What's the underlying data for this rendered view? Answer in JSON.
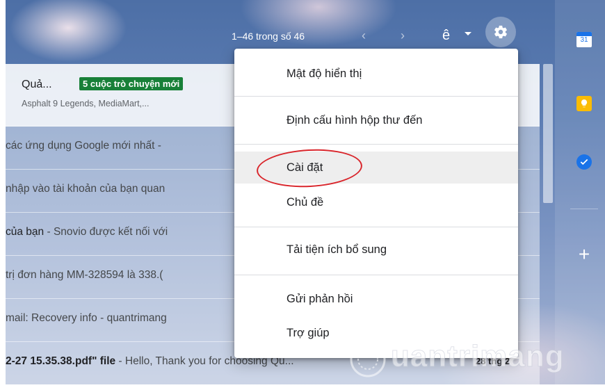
{
  "toolbar": {
    "pager": "1–46 trong số 46",
    "prev_arrow": "‹",
    "next_arrow": "›",
    "input_tool": "ê"
  },
  "inbox": {
    "promo": {
      "title": "Quả...",
      "badge": "5 cuộc trò chuyện mới",
      "senders": "Asphalt 9 Legends, MediaMart,..."
    },
    "rows": [
      {
        "subject": "",
        "snippet": "các ứng dụng Google mới nhất -",
        "unread": false
      },
      {
        "subject": "",
        "snippet": "nhập vào tài khoản của bạn quan",
        "unread": false
      },
      {
        "subject": "của bạn",
        "snippet": " - Snovio được kết nối với",
        "unread": false
      },
      {
        "subject": "",
        "snippet": "trị đơn hàng MM-328594 là 338.(",
        "unread": false
      },
      {
        "subject": "",
        "snippet": "mail: Recovery info - quantrimang",
        "unread": false
      },
      {
        "subject": "2-27 15.35.38.pdf\" file",
        "snippet": " - Hello, Thank you for choosing Qu...",
        "date": "28 thg 2",
        "unread": true
      }
    ]
  },
  "settings_menu": {
    "items": [
      {
        "label": "Mật độ hiển thị"
      },
      {
        "label": "Định cấu hình hộp thư đến"
      },
      {
        "label": "Cài đặt"
      },
      {
        "label": "Chủ đề"
      },
      {
        "label": "Tải tiện ích bổ sung"
      },
      {
        "label": "Gửi phản hồi"
      },
      {
        "label": "Trợ giúp"
      }
    ]
  },
  "side_panel": {
    "calendar_day": "31",
    "add_label": "+"
  },
  "watermark": "uantrimang",
  "colors": {
    "badge_green": "#188038",
    "highlight_red": "#d9252b",
    "calendar_blue": "#1a73e8",
    "keep_yellow": "#fbbc04"
  },
  "icons": [
    "settings-gear-icon",
    "calendar-icon",
    "keep-icon",
    "tasks-icon",
    "add-icon",
    "watermark-logo-icon"
  ]
}
